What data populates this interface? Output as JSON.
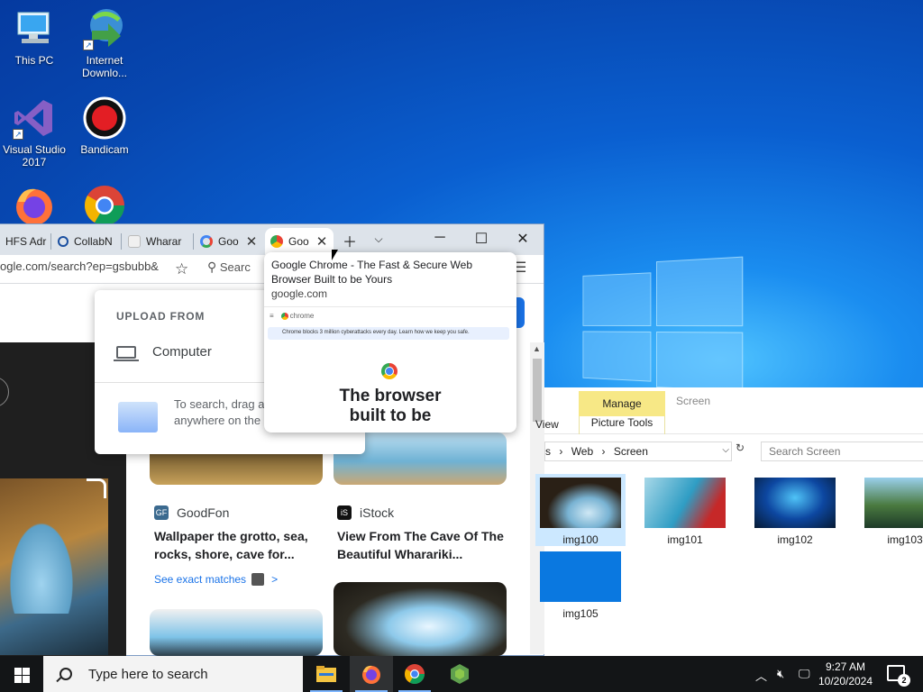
{
  "desktop": {
    "icons": [
      {
        "label": "This PC",
        "icon": "this-pc-icon"
      },
      {
        "label": "Internet Downlo...",
        "icon": "internet-download-manager-icon"
      },
      {
        "label": "Visual Studio 2017",
        "icon": "visual-studio-icon"
      },
      {
        "label": "Bandicam",
        "icon": "bandicam-icon"
      },
      {
        "label": "",
        "icon": "firefox-icon"
      },
      {
        "label": "",
        "icon": "chrome-icon"
      }
    ]
  },
  "browser": {
    "tabs": [
      {
        "title": "HFS Adr",
        "icon": "hfs-icon"
      },
      {
        "title": "CollabN",
        "icon": "search-icon"
      },
      {
        "title": "Wharar",
        "icon": "wharariki-icon"
      },
      {
        "title": "Goo",
        "icon": "google-lens-icon"
      },
      {
        "title": "Goo",
        "icon": "chrome-icon",
        "active": true
      }
    ],
    "url": "ogle.com/search?ep=gsbubb&",
    "search_placeholder": "Searc",
    "upload": {
      "heading": "UPLOAD FROM",
      "computer_label": "Computer",
      "drag_text": "To search, drag a anywhere on the"
    },
    "results": [
      {
        "source": "GoodFon",
        "source_icon_text": "GF",
        "title": "Wallpaper the grotto, sea, rocks, shore, cave for..."
      },
      {
        "source": "iStock",
        "source_icon_text": "iS",
        "title": "View From The Cave Of The Beautiful Wharariki..."
      }
    ],
    "exact_matches": "See exact matches",
    "exact_matches_arrow": ">"
  },
  "hovercard": {
    "title": "Google Chrome - The Fast & Secure Web Browser Built to be Yours",
    "domain": "google.com",
    "preview_nav": "chrome",
    "preview_banner": "Chrome blocks 3 million cyberattacks every day. Learn how we keep you safe.",
    "preview_headline": "The browser built to be"
  },
  "explorer": {
    "manage_tab": "Manage",
    "picture_tools": "Picture Tools",
    "screen_tab": "Screen",
    "view_tab": "View",
    "path": [
      "s",
      "Web",
      "Screen"
    ],
    "search_placeholder": "Search Screen",
    "files": [
      {
        "name": "img100",
        "selected": true
      },
      {
        "name": "img101"
      },
      {
        "name": "img102"
      },
      {
        "name": "img103"
      },
      {
        "name": "img105"
      }
    ]
  },
  "taskbar": {
    "search_placeholder": "Type here to search",
    "apps": [
      "file-explorer-icon",
      "firefox-icon",
      "chrome-icon",
      "node-icon"
    ],
    "time": "9:27 AM",
    "date": "10/20/2024",
    "notification_count": "2"
  },
  "colors": {
    "accent": "#1a73e8",
    "manage_tab": "#f7e886",
    "taskbar": "#131517"
  }
}
